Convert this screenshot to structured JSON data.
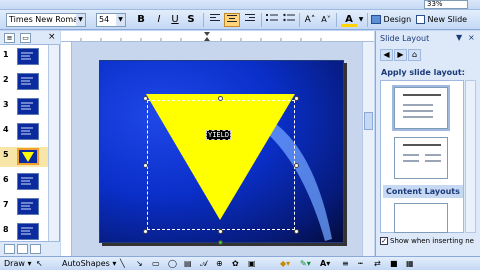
{
  "toolbar": {
    "zoom": "33%",
    "font_name": "Times New Roman",
    "font_size": "54",
    "bold": "B",
    "italic": "I",
    "underline": "U",
    "shadow": "S",
    "design_label": "Design",
    "new_slide_label": "New Slide",
    "font_color_label": "A",
    "grow_font_label": "A˄",
    "shrink_font_label": "A˅"
  },
  "slides_pane": {
    "slides": [
      {
        "num": "1"
      },
      {
        "num": "2"
      },
      {
        "num": "3"
      },
      {
        "num": "4"
      },
      {
        "num": "5"
      },
      {
        "num": "6"
      },
      {
        "num": "7"
      },
      {
        "num": "8"
      }
    ],
    "selected_index": 5
  },
  "slide": {
    "placeholder_text": "YIELD",
    "colors": {
      "background": "#0a2fc9",
      "triangle": "#ffff00",
      "swoosh": "#6fa3ff"
    }
  },
  "task_pane": {
    "title": "Slide Layout",
    "apply_label": "Apply slide layout:",
    "section_label": "Content Layouts",
    "checkbox_label": "Show when inserting ne",
    "checkbox_checked": true
  },
  "draw_toolbar": {
    "draw_label": "Draw",
    "autoshapes_label": "AutoShapes"
  }
}
